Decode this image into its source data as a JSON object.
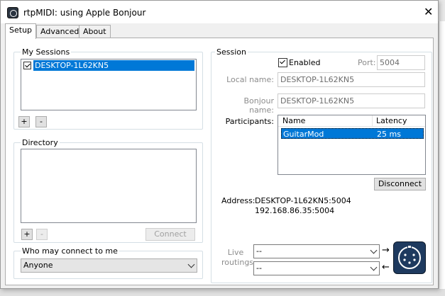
{
  "window": {
    "title": "rtpMIDI: using Apple Bonjour",
    "close_glyph": "✕"
  },
  "tabs": [
    {
      "label": "Setup",
      "active": true
    },
    {
      "label": "Advanced",
      "active": false
    },
    {
      "label": "About",
      "active": false
    }
  ],
  "my_sessions": {
    "label": "My Sessions",
    "items": [
      {
        "label": "DESKTOP-1L62KN5",
        "checked": true,
        "selected": true
      }
    ],
    "add_label": "+",
    "remove_label": "-"
  },
  "directory": {
    "label": "Directory",
    "add_label": "+",
    "remove_label": "-",
    "connect_label": "Connect"
  },
  "who_may_connect": {
    "label": "Who may connect to me",
    "value": "Anyone"
  },
  "session": {
    "label": "Session",
    "enabled_label": "Enabled",
    "enabled": true,
    "port_label": "Port:",
    "port_value": "5004",
    "local_name_label": "Local name:",
    "local_name_value": "DESKTOP-1L62KN5",
    "bonjour_name_label": "Bonjour name:",
    "bonjour_name_value": "DESKTOP-1L62KN5",
    "participants_label": "Participants:",
    "participants_columns": [
      "Name",
      "Latency"
    ],
    "participants": [
      {
        "name": "GuitarMod",
        "latency": "25 ms",
        "selected": true
      }
    ],
    "disconnect_label": "Disconnect",
    "address_label": "Address:",
    "address_line1": "DESKTOP-1L62KN5:5004",
    "address_line2": "192.168.86.35:5004",
    "live_routings_label": "Live\nroutings",
    "route_in_value": "--",
    "route_out_value": "--",
    "arrow_right_glyph": "→",
    "arrow_left_glyph": "←"
  },
  "colors": {
    "selection": "#0078d7",
    "group_border": "#d5dfe5",
    "midi_icon_bg": "#1e3a5f"
  },
  "icons": {
    "app": "rtpmidi-app-icon",
    "midi": "midi-connector-icon"
  }
}
